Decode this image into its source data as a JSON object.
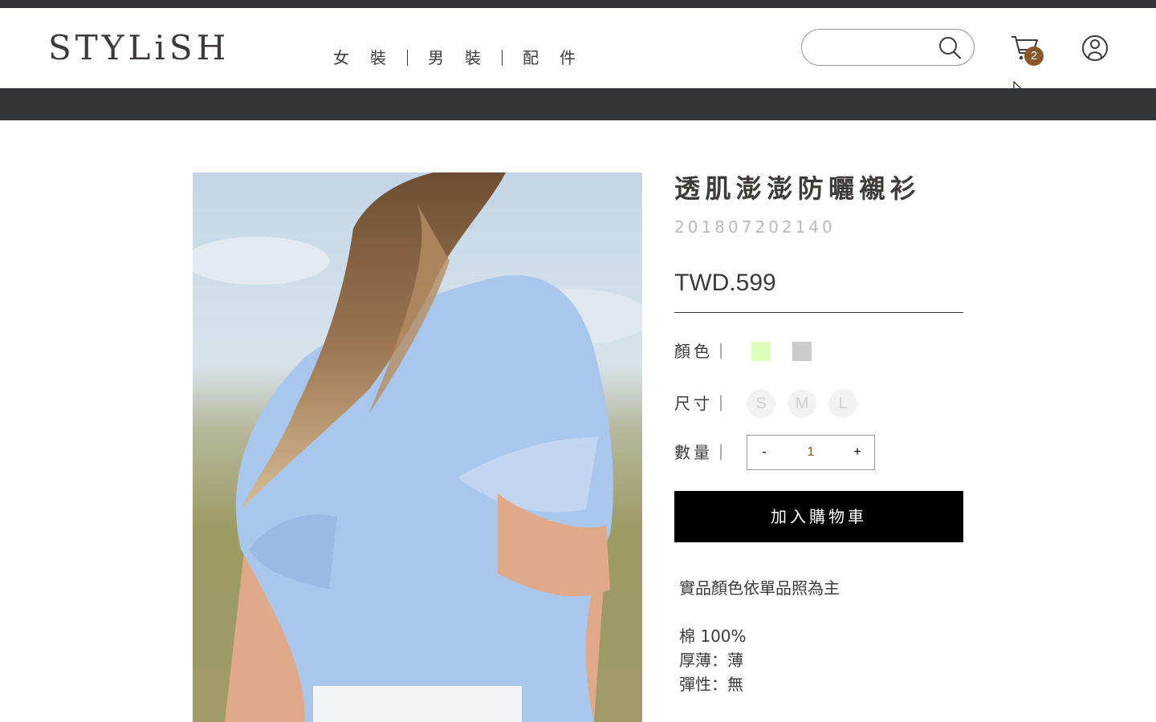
{
  "header": {
    "logo": "STYLiSH",
    "nav": [
      {
        "label": "女裝"
      },
      {
        "label": "男裝"
      },
      {
        "label": "配件"
      }
    ],
    "search": {
      "placeholder": "",
      "value": ""
    },
    "cart_count": "2"
  },
  "product": {
    "title": "透肌澎澎防曬襯衫",
    "sku": "201807202140",
    "price": "TWD.599",
    "color_label": "顏色｜",
    "colors": [
      "#DDFFBB",
      "#CCCCCC"
    ],
    "size_label": "尺寸｜",
    "sizes": [
      "S",
      "M",
      "L"
    ],
    "quantity_label": "數量｜",
    "quantity": {
      "minus": "-",
      "value": "1",
      "plus": "+"
    },
    "add_to_cart": "加入購物車",
    "notes": [
      "實品顏色依單品照為主",
      "",
      "棉 100%",
      "厚薄：薄",
      "彈性：無"
    ]
  },
  "colors": {
    "topbar": "#313538",
    "badge": "#8B572A",
    "text": "#3F3A3A",
    "muted": "#BABABA"
  }
}
